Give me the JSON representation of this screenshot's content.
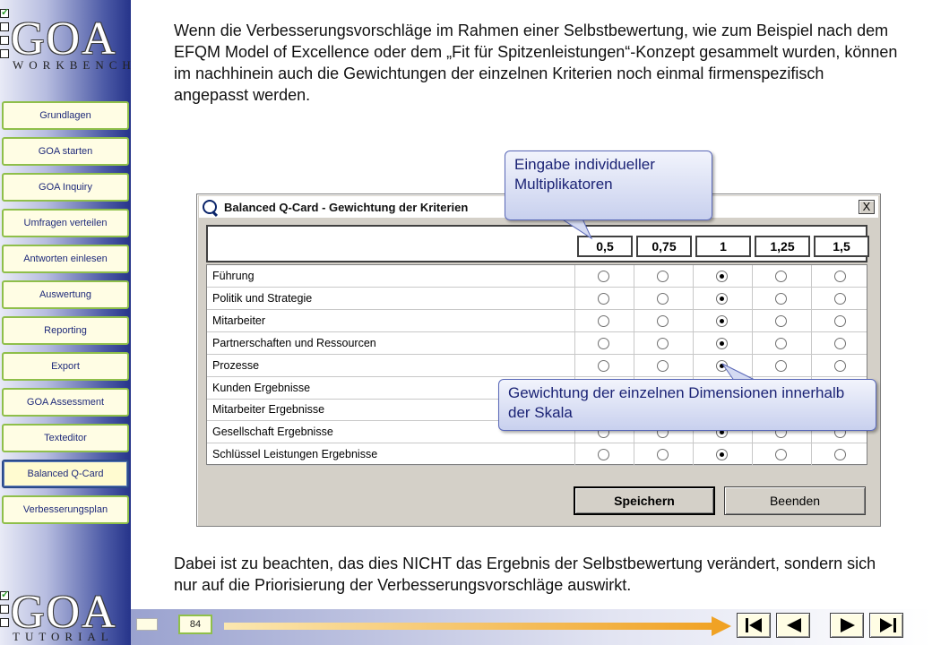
{
  "logo_top": {
    "letters": "GOA",
    "word": "WORKBENCH"
  },
  "logo_bottom": {
    "letters": "GOA",
    "word": "TUTORIAL"
  },
  "nav": {
    "items": [
      {
        "label": "Grundlagen"
      },
      {
        "label": "GOA starten"
      },
      {
        "label": "GOA Inquiry"
      },
      {
        "label": "Umfragen verteilen"
      },
      {
        "label": "Antworten einlesen"
      },
      {
        "label": "Auswertung"
      },
      {
        "label": "Reporting"
      },
      {
        "label": "Export"
      },
      {
        "label": "GOA Assessment"
      },
      {
        "label": "Texteditor"
      },
      {
        "label": "Balanced Q-Card"
      },
      {
        "label": "Verbesserungsplan"
      }
    ],
    "active": "Balanced Q-Card"
  },
  "main": {
    "para1": "Wenn die Verbesserungsvorschläge im Rahmen einer Selbstbewertung, wie zum Beispiel nach dem EFQM Model of Excellence oder dem „Fit für Spitzenleistungen“-Konzept gesammelt wurden, können im nachhinein auch die Gewichtungen der einzelnen Kriterien noch einmal firmenspezifisch angepasst werden.",
    "para2": "Dabei ist zu beachten, das dies NICHT das Ergebnis der Selbstbewertung verändert, sondern sich nur auf die Priorisierung der Verbesserungsvorschläge auswirkt."
  },
  "dialog": {
    "title": "Balanced Q-Card - Gewichtung der Kriterien",
    "close_label": "X",
    "weights": [
      "0,5",
      "0,75",
      "1",
      "1,25",
      "1,5"
    ],
    "criteria": [
      {
        "label": "Führung",
        "selected": 2
      },
      {
        "label": "Politik und Strategie",
        "selected": 2
      },
      {
        "label": "Mitarbeiter",
        "selected": 2
      },
      {
        "label": "Partnerschaften und Ressourcen",
        "selected": 2
      },
      {
        "label": "Prozesse",
        "selected": 2
      },
      {
        "label": "Kunden Ergebnisse",
        "selected": 2
      },
      {
        "label": "Mitarbeiter Ergebnisse",
        "selected": 2
      },
      {
        "label": "Gesellschaft Ergebnisse",
        "selected": 2
      },
      {
        "label": "Schlüssel Leistungen Ergebnisse",
        "selected": 2
      }
    ],
    "save_label": "Speichern",
    "quit_label": "Beenden"
  },
  "callouts": {
    "c1": "Eingabe individueller Multiplikatoren",
    "c2": "Gewichtung der einzelnen Dimensionen innerhalb der Skala"
  },
  "footer": {
    "page_number": "84"
  },
  "colors": {
    "accent_green": "#8fbf4a",
    "arrow_orange": "#f0a020",
    "callout_text": "#1b2375"
  },
  "icons": [
    "first-page-icon",
    "previous-page-icon",
    "next-page-icon",
    "last-page-icon",
    "arrow-right-icon"
  ]
}
